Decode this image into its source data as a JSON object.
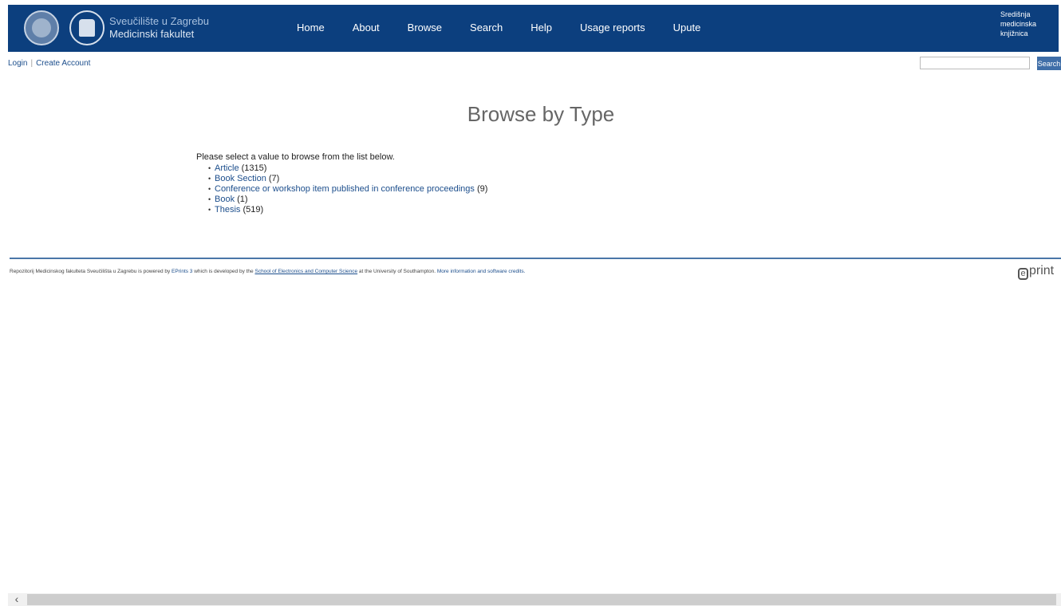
{
  "header": {
    "brand_line1": "Sveučilište u Zagrebu",
    "brand_line2": "Medicinski fakultet",
    "nav": [
      "Home",
      "About",
      "Browse",
      "Search",
      "Help",
      "Usage reports",
      "Upute"
    ],
    "side_text": [
      "Središnja",
      "medicinska",
      "knjižnica"
    ],
    "background_color": "#0c3f7e"
  },
  "topbar": {
    "login": "Login",
    "create_account": "Create Account",
    "search_placeholder": "",
    "search_button": "Search"
  },
  "page": {
    "title": "Browse by Type",
    "intro": "Please select a value to browse from the list below.",
    "items": [
      {
        "label": "Article",
        "count": "(1315)"
      },
      {
        "label": "Book Section",
        "count": "(7)"
      },
      {
        "label": "Conference or workshop item published in conference proceedings",
        "count": "(9)"
      },
      {
        "label": "Book",
        "count": "(1)"
      },
      {
        "label": "Thesis",
        "count": "(519)"
      }
    ]
  },
  "footer": {
    "text1": "Repozitorij Medicinskog fakulteta Sveučilišta u Zagrebu is powered by ",
    "eprints_link": "EPrints 3",
    "text2": " which is developed by the ",
    "school_link": "School of Electronics and Computer Science",
    "text3": " at the University of Southampton. ",
    "more_link": "More information and software credits.",
    "logo_text": "print"
  }
}
